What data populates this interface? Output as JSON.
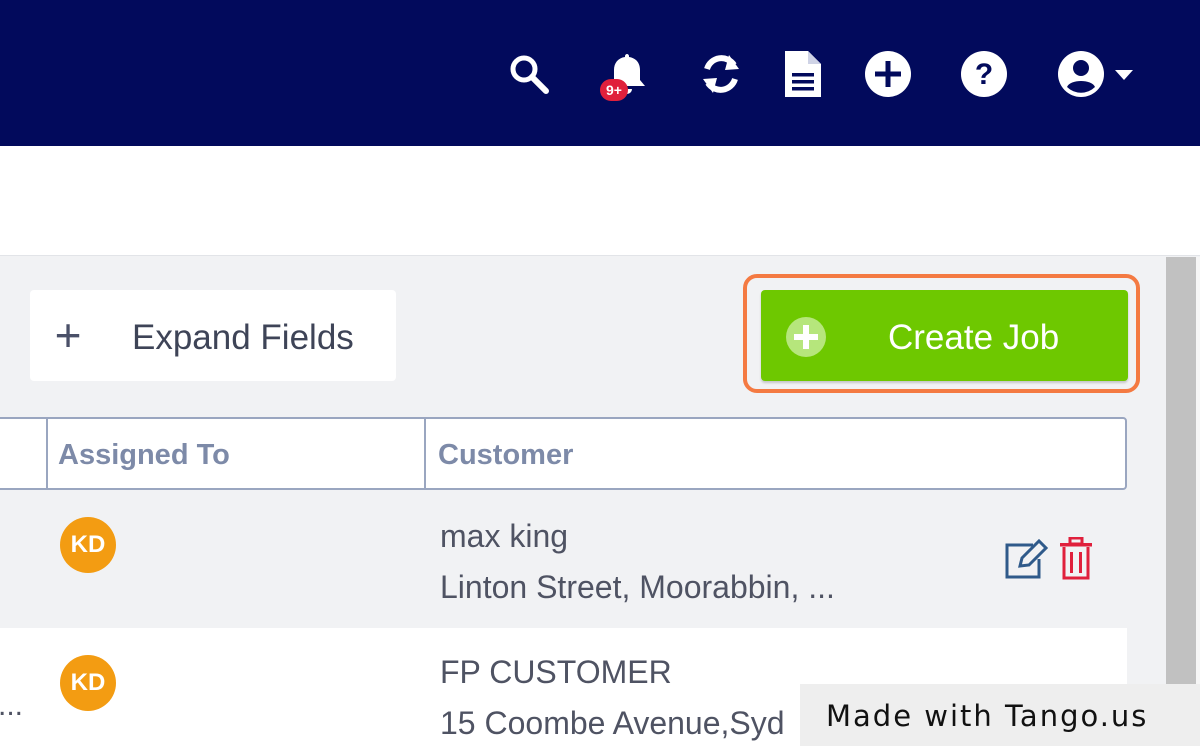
{
  "header": {
    "notification_badge": "9+",
    "icons": [
      "search-icon",
      "bell-icon",
      "sync-icon",
      "document-icon",
      "plus-circle-icon",
      "help-icon",
      "user-icon",
      "caret-down-icon"
    ]
  },
  "toolbar": {
    "expand_label": "Expand Fields",
    "expand_icon": "+",
    "create_label": "Create Job"
  },
  "table": {
    "columns": [
      "Assigned To",
      "Customer"
    ],
    "rows": [
      {
        "assigned_initials": "KD",
        "customer_name": "max king",
        "customer_address": "Linton Street, Moorabbin, ..."
      },
      {
        "assigned_initials": "KD",
        "customer_name": "FP CUSTOMER",
        "customer_address": "15 Coombe Avenue,Syd",
        "leading_truncated": "..."
      }
    ]
  },
  "watermark": {
    "text": "Made with Tango.us"
  },
  "colors": {
    "topbar": "#020a5c",
    "create_button": "#6ec800",
    "highlight": "#f47a42",
    "avatar": "#f39c12",
    "badge": "#e0203c",
    "edit_icon": "#2f5a8a",
    "delete_icon": "#e0203c"
  }
}
